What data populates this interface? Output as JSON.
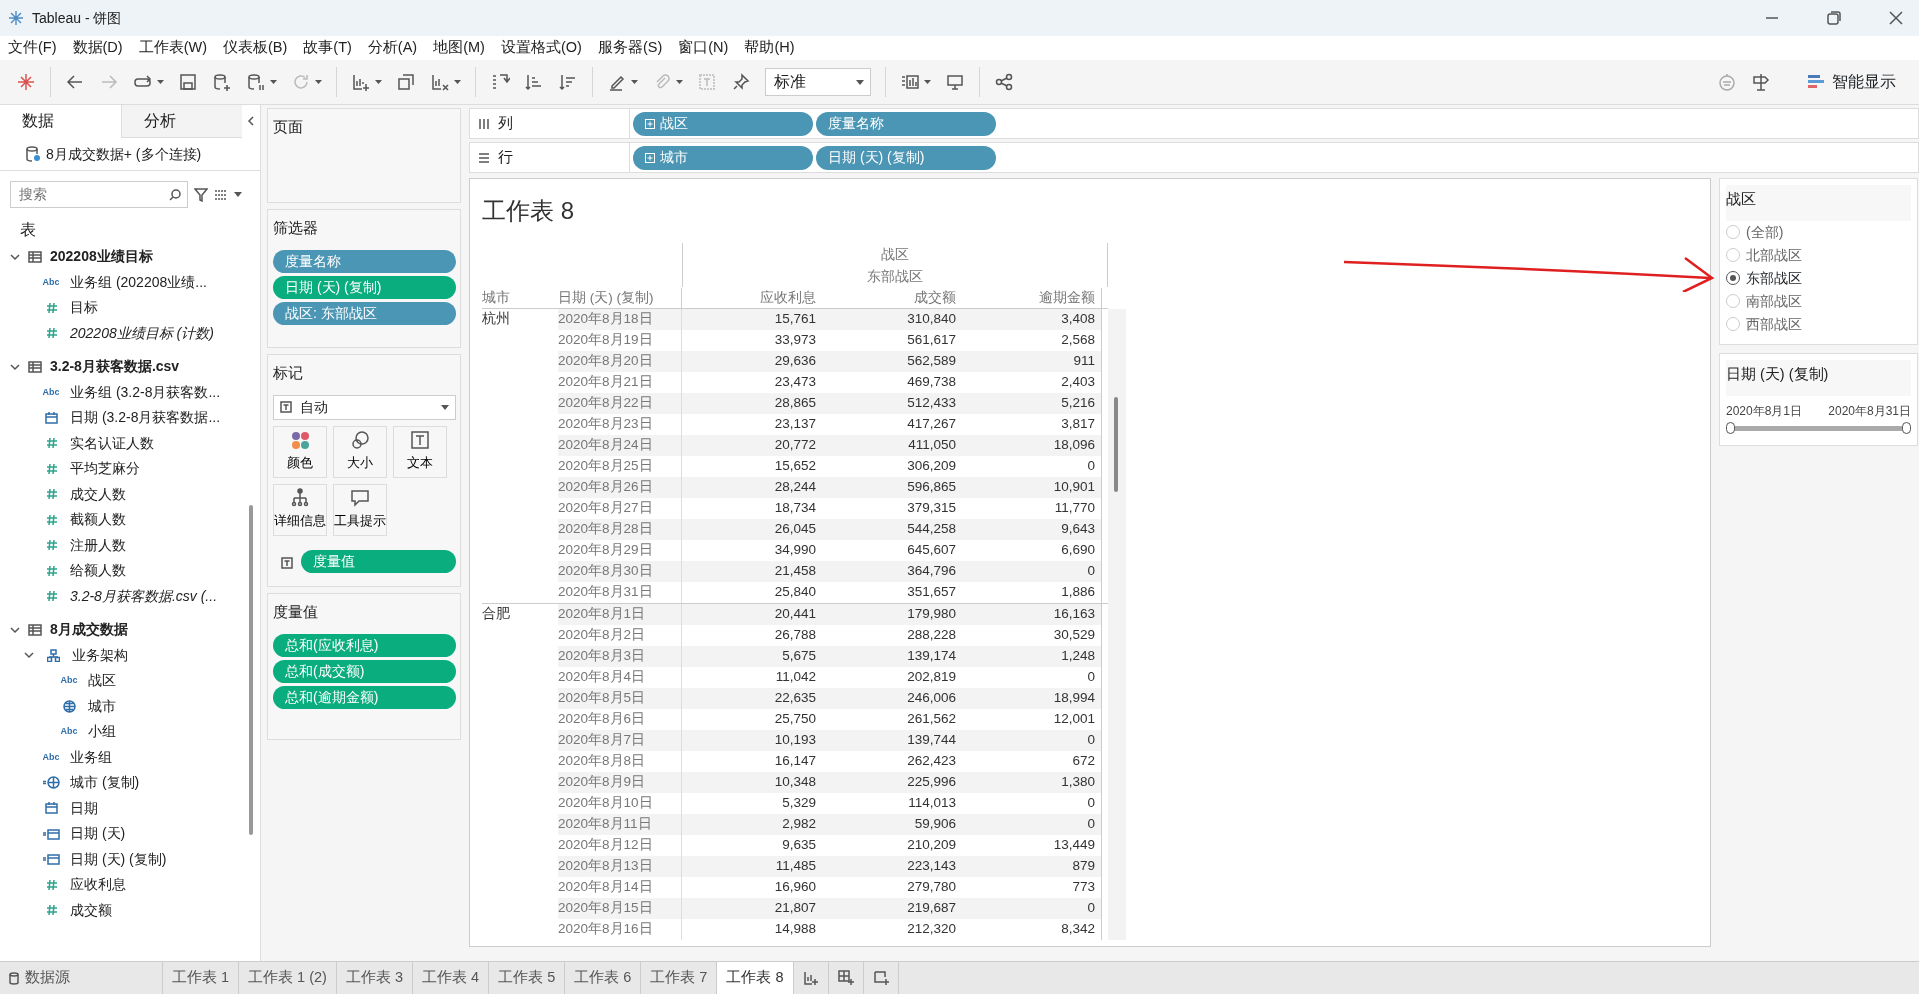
{
  "window": {
    "title": "Tableau - 饼图"
  },
  "menu": [
    "文件(F)",
    "数据(D)",
    "工作表(W)",
    "仪表板(B)",
    "故事(T)",
    "分析(A)",
    "地图(M)",
    "设置格式(O)",
    "服务器(S)",
    "窗口(N)",
    "帮助(H)"
  ],
  "toolbar": {
    "view_size": "标准",
    "show_me": "智能显示"
  },
  "data_pane": {
    "tabs": [
      {
        "label": "数据",
        "selected": true
      },
      {
        "label": "分析",
        "selected": false
      }
    ],
    "connection": "8月成交数据+ (多个连接)",
    "search": {
      "placeholder": "搜索"
    },
    "section_title": "表",
    "tables": [
      {
        "name": "202208业绩目标",
        "expanded": true,
        "fields": [
          {
            "kind": "text",
            "badge": "Abc",
            "name": "业务组 (202208业绩..."
          },
          {
            "kind": "number",
            "name": "目标"
          },
          {
            "kind": "count",
            "name": "202208业绩目标 (计数)"
          }
        ]
      },
      {
        "name": "3.2-8月获客数据.csv",
        "expanded": true,
        "fields": [
          {
            "kind": "text",
            "badge": "Abc",
            "name": "业务组 (3.2-8月获客数..."
          },
          {
            "kind": "date",
            "name": "日期 (3.2-8月获客数据..."
          },
          {
            "kind": "number",
            "name": "实名认证人数"
          },
          {
            "kind": "number",
            "name": "平均芝麻分"
          },
          {
            "kind": "number",
            "name": "成交人数"
          },
          {
            "kind": "number",
            "name": "截额人数"
          },
          {
            "kind": "number",
            "name": "注册人数"
          },
          {
            "kind": "number",
            "name": "给额人数"
          },
          {
            "kind": "count",
            "name": "3.2-8月获客数据.csv (..."
          }
        ]
      },
      {
        "name": "8月成交数据",
        "expanded": true,
        "fields": [
          {
            "kind": "hierarchy",
            "name": "业务架构",
            "expanded": true,
            "children": [
              {
                "kind": "text",
                "badge": "Abc",
                "name": "战区"
              },
              {
                "kind": "geo",
                "name": "城市"
              },
              {
                "kind": "text",
                "badge": "Abc",
                "name": "小组"
              }
            ]
          },
          {
            "kind": "text",
            "badge": "Abc",
            "name": "业务组"
          },
          {
            "kind": "geo-calc",
            "name": "城市 (复制)"
          },
          {
            "kind": "date",
            "name": "日期"
          },
          {
            "kind": "date-calc",
            "name": "日期 (天)"
          },
          {
            "kind": "date-calc",
            "name": "日期 (天) (复制)"
          },
          {
            "kind": "number",
            "name": "应收利息"
          },
          {
            "kind": "number",
            "name": "成交额"
          }
        ]
      }
    ]
  },
  "pages_card": {
    "title": "页面"
  },
  "filters_card": {
    "title": "筛选器",
    "pills": [
      {
        "label": "度量名称",
        "color": "#4a96b4"
      },
      {
        "label": "日期 (天) (复制)",
        "color": "#0aad7d"
      },
      {
        "label": "战区: 东部战区",
        "color": "#4a96b4"
      }
    ]
  },
  "marks_card": {
    "title": "标记",
    "mark_type": "自动",
    "buttons": [
      "颜色",
      "大小",
      "文本",
      "详细信息",
      "工具提示"
    ],
    "pills": [
      {
        "label": "度量值",
        "color": "#0aad7d"
      }
    ]
  },
  "measure_values_card": {
    "title": "度量值",
    "pills": [
      {
        "label": "总和(应收利息)",
        "color": "#0aad7d"
      },
      {
        "label": "总和(成交额)",
        "color": "#0aad7d"
      },
      {
        "label": "总和(逾期金额)",
        "color": "#0aad7d"
      }
    ]
  },
  "columns_shelf": {
    "label": "列",
    "pills": [
      {
        "label": "战区",
        "expandable": true,
        "color": "#4a96b4"
      },
      {
        "label": "度量名称",
        "expandable": false,
        "color": "#4a96b4"
      }
    ]
  },
  "rows_shelf": {
    "label": "行",
    "pills": [
      {
        "label": "城市",
        "expandable": true,
        "color": "#4a96b4"
      },
      {
        "label": "日期 (天) (复制)",
        "expandable": false,
        "color": "#4a96b4"
      }
    ]
  },
  "sheet": {
    "title": "工作表 8",
    "group_label": "战区",
    "group_value": "东部战区",
    "row_headers": [
      "城市",
      "日期 (天) (复制)"
    ],
    "columns": [
      "应收利息",
      "成交额",
      "逾期金额"
    ],
    "groups": [
      {
        "city": "杭州",
        "rows": [
          [
            "2020年8月18日",
            "15,761",
            "310,840",
            "3,408"
          ],
          [
            "2020年8月19日",
            "33,973",
            "561,617",
            "2,568"
          ],
          [
            "2020年8月20日",
            "29,636",
            "562,589",
            "911"
          ],
          [
            "2020年8月21日",
            "23,473",
            "469,738",
            "2,403"
          ],
          [
            "2020年8月22日",
            "28,865",
            "512,433",
            "5,216"
          ],
          [
            "2020年8月23日",
            "23,137",
            "417,267",
            "3,817"
          ],
          [
            "2020年8月24日",
            "20,772",
            "411,050",
            "18,096"
          ],
          [
            "2020年8月25日",
            "15,652",
            "306,209",
            "0"
          ],
          [
            "2020年8月26日",
            "28,244",
            "596,865",
            "10,901"
          ],
          [
            "2020年8月27日",
            "18,734",
            "379,315",
            "11,770"
          ],
          [
            "2020年8月28日",
            "26,045",
            "544,258",
            "9,643"
          ],
          [
            "2020年8月29日",
            "34,990",
            "645,607",
            "6,690"
          ],
          [
            "2020年8月30日",
            "21,458",
            "364,796",
            "0"
          ],
          [
            "2020年8月31日",
            "25,840",
            "351,657",
            "1,886"
          ]
        ]
      },
      {
        "city": "合肥",
        "rows": [
          [
            "2020年8月1日",
            "20,441",
            "179,980",
            "16,163"
          ],
          [
            "2020年8月2日",
            "26,788",
            "288,228",
            "30,529"
          ],
          [
            "2020年8月3日",
            "5,675",
            "139,174",
            "1,248"
          ],
          [
            "2020年8月4日",
            "11,042",
            "202,819",
            "0"
          ],
          [
            "2020年8月5日",
            "22,635",
            "246,006",
            "18,994"
          ],
          [
            "2020年8月6日",
            "25,750",
            "261,562",
            "12,001"
          ],
          [
            "2020年8月7日",
            "10,193",
            "139,744",
            "0"
          ],
          [
            "2020年8月8日",
            "16,147",
            "262,423",
            "672"
          ],
          [
            "2020年8月9日",
            "10,348",
            "225,996",
            "1,380"
          ],
          [
            "2020年8月10日",
            "5,329",
            "114,013",
            "0"
          ],
          [
            "2020年8月11日",
            "2,982",
            "59,906",
            "0"
          ],
          [
            "2020年8月12日",
            "9,635",
            "210,209",
            "13,449"
          ],
          [
            "2020年8月13日",
            "11,485",
            "223,143",
            "879"
          ],
          [
            "2020年8月14日",
            "16,960",
            "279,780",
            "773"
          ],
          [
            "2020年8月15日",
            "21,807",
            "219,687",
            "0"
          ],
          [
            "2020年8月16日",
            "14,988",
            "212,320",
            "8,342"
          ]
        ]
      }
    ]
  },
  "region_filter": {
    "title": "战区",
    "options": [
      {
        "label": "(全部)",
        "selected": false
      },
      {
        "label": "北部战区",
        "selected": false
      },
      {
        "label": "东部战区",
        "selected": true
      },
      {
        "label": "南部战区",
        "selected": false
      },
      {
        "label": "西部战区",
        "selected": false
      }
    ]
  },
  "date_filter": {
    "title": "日期 (天) (复制)",
    "start": "2020年8月1日",
    "end": "2020年8月31日",
    "level": 1
  },
  "sheet_tabs": {
    "data_source": "数据源",
    "tabs": [
      {
        "label": "工作表 1",
        "selected": false
      },
      {
        "label": "工作表 1 (2)",
        "selected": false
      },
      {
        "label": "工作表 3",
        "selected": false
      },
      {
        "label": "工作表 4",
        "selected": false
      },
      {
        "label": "工作表 5",
        "selected": false
      },
      {
        "label": "工作表 6",
        "selected": false
      },
      {
        "label": "工作表 7",
        "selected": false
      },
      {
        "label": "工作表 8",
        "selected": true
      }
    ]
  }
}
